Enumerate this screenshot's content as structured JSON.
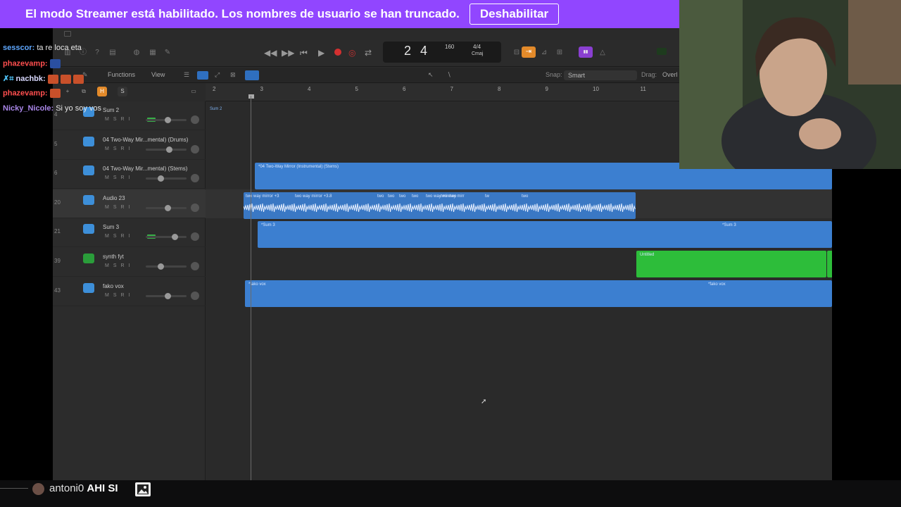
{
  "banner": {
    "text": "El modo Streamer está habilitado. Los nombres de usuario se han truncado.",
    "button_label": "Deshabilitar"
  },
  "logic": {
    "lcd": {
      "bar": "2",
      "beat": "4",
      "tempo": "160",
      "time_signature": "4/4",
      "key": "Cmaj"
    },
    "menu": {
      "functions": "Functions",
      "view": "View",
      "snap_label": "Snap:",
      "snap_value": "Smart",
      "drag_label": "Drag:",
      "drag_value": "Overl"
    },
    "header_buttons": {
      "h": "H",
      "s": "S"
    },
    "msri": {
      "m": "M",
      "s": "S",
      "r": "R",
      "i": "I"
    },
    "tracks": [
      {
        "num": "4",
        "name": "Sum 2",
        "icon": "stack-icon",
        "fader": 0.55,
        "meter": true
      },
      {
        "num": "5",
        "name": "04 Two-Way Mir...mental) (Drums)",
        "icon": "drum-icon",
        "fader": 0.6
      },
      {
        "num": "6",
        "name": "04 Two-Way Mir...mental) (Stems)",
        "icon": "stack-icon",
        "fader": 0.35
      },
      {
        "num": "20",
        "name": "Audio 23",
        "icon": "waveform-icon",
        "fader": 0.55,
        "selected": true
      },
      {
        "num": "21",
        "name": "Sum 3",
        "icon": "stack-icon",
        "fader": 0.75,
        "meter": true
      },
      {
        "num": "39",
        "name": "synth fyt",
        "icon": "synth-icon",
        "fader": 0.35
      },
      {
        "num": "43",
        "name": "fako vox",
        "icon": "stack-icon",
        "fader": 0.55
      }
    ],
    "ruler": [
      "2",
      "3",
      "4",
      "5",
      "6",
      "7",
      "8",
      "9",
      "10",
      "11"
    ],
    "regions": {
      "sum2": "Sum 2",
      "stems": "*04 Two-Way Mirror (Instrumental) (Stems)",
      "audio": [
        "two way mirror +3",
        "two way mirror +3.8",
        "two",
        "two",
        "two",
        "two",
        "two way mirr",
        "two way mirr",
        "two",
        "tw",
        "two"
      ],
      "sum3_a": "*Sum 3",
      "sum3_b": "*Sum 3",
      "untitled": "Untitled",
      "fako_a": "*fako vox",
      "fako_b": "*fako vox"
    }
  },
  "chat": [
    {
      "user": "sesscor",
      "color": "#5fa8ff",
      "msg": "ta re loca eta"
    },
    {
      "user": "phazevamp",
      "color": "#ff4f4f",
      "msg": ""
    },
    {
      "user": "nachbk",
      "color": "#d9d9ff",
      "msg": ""
    },
    {
      "user": "phazevamp",
      "color": "#ff4f4f",
      "msg": ""
    },
    {
      "user": "Nicky_Nicole",
      "color": "#a986e8",
      "msg": "Si yo soy vos"
    }
  ],
  "bottom": {
    "user": "antoni0",
    "msg": "AHI SI"
  }
}
